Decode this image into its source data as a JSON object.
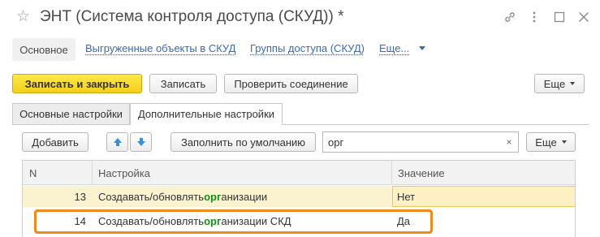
{
  "window": {
    "modified_marker": "☆",
    "title": "ЭНТ (Система контроля доступа (СКУД)) *"
  },
  "nav": {
    "active": "Основное",
    "links": [
      "Выгруженные объекты в СКУД",
      "Группы доступа (СКУД)",
      "Еще..."
    ]
  },
  "toolbar": {
    "save_close": "Записать и закрыть",
    "save": "Записать",
    "check_connection": "Проверить соединение",
    "more": "Еще"
  },
  "tabs": [
    "Основные настройки",
    "Дополнительные настройки"
  ],
  "settings_toolbar": {
    "add": "Добавить",
    "fill_default": "Заполнить по умолчанию",
    "search_value": "орг",
    "clear": "×",
    "more": "Еще"
  },
  "table": {
    "columns": [
      "N",
      "Настройка",
      "Значение"
    ],
    "rows": [
      {
        "n": "13",
        "pre": "Создавать/обновлять ",
        "match": "орг",
        "post": "анизации",
        "value": "Нет"
      },
      {
        "n": "14",
        "pre": "Создавать/обновлять ",
        "match": "орг",
        "post": "анизации СКД",
        "value": "Да"
      }
    ]
  },
  "colors": {
    "primary_button": "#f4cf19",
    "link": "#3a6ab3",
    "match_highlight": "#1b8a1b",
    "selected_row": "#fbf2cf",
    "annotation_frame": "#f08a1c"
  }
}
